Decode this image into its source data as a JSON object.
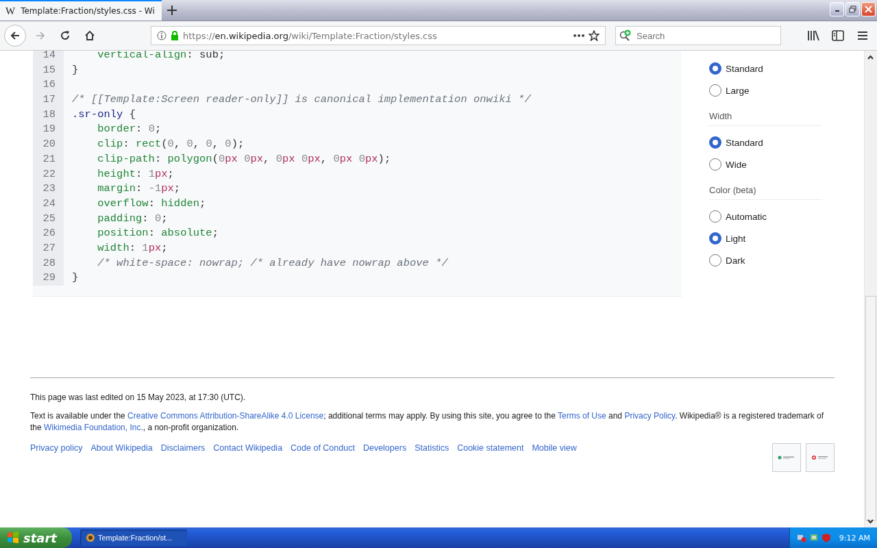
{
  "browser": {
    "tab": {
      "icon": "W",
      "title": "Template:Fraction/styles.css - Wi",
      "selected": true
    },
    "url": {
      "scheme": "https://",
      "domain": "en.wikipedia.org",
      "path": "/wiki/Template:Fraction/styles.css"
    },
    "search": {
      "placeholder": "Search"
    }
  },
  "code": {
    "lines": [
      {
        "number": "14",
        "indented": true,
        "tokens": [
          {
            "kind": "prop",
            "text": "vertical-align"
          },
          {
            "kind": "plain",
            "text": ": sub;"
          }
        ]
      },
      {
        "number": "15",
        "indented": false,
        "tokens": [
          {
            "kind": "plain",
            "text": "}"
          }
        ]
      },
      {
        "number": "16",
        "indented": false
      },
      {
        "number": "17",
        "indented": false,
        "tokens": [
          {
            "kind": "comment",
            "text": "/* [[Template:Screen reader-only]] is canonical implementation onwiki */"
          }
        ]
      },
      {
        "number": "18",
        "indented": false,
        "tokens": [
          {
            "kind": "selector",
            "text": ".sr-only"
          },
          {
            "kind": "plain",
            "text": " {"
          }
        ]
      },
      {
        "number": "19",
        "indented": true,
        "tokens": [
          {
            "kind": "prop",
            "text": "border"
          },
          {
            "kind": "plain",
            "text": ": "
          },
          {
            "kind": "num",
            "text": "0"
          },
          {
            "kind": "plain",
            "text": ";"
          }
        ]
      },
      {
        "number": "20",
        "indented": true,
        "tokens": [
          {
            "kind": "prop",
            "text": "clip"
          },
          {
            "kind": "plain",
            "text": ": "
          },
          {
            "kind": "func",
            "text": "rect"
          },
          {
            "kind": "plain",
            "text": "("
          },
          {
            "kind": "num",
            "text": "0"
          },
          {
            "kind": "plain",
            "text": ", "
          },
          {
            "kind": "num",
            "text": "0"
          },
          {
            "kind": "plain",
            "text": ", "
          },
          {
            "kind": "num",
            "text": "0"
          },
          {
            "kind": "plain",
            "text": ", "
          },
          {
            "kind": "num",
            "text": "0"
          },
          {
            "kind": "plain",
            "text": ");"
          }
        ]
      },
      {
        "number": "21",
        "indented": true,
        "tokens": [
          {
            "kind": "prop",
            "text": "clip-path"
          },
          {
            "kind": "plain",
            "text": ": "
          },
          {
            "kind": "func",
            "text": "polygon"
          },
          {
            "kind": "plain",
            "text": "("
          },
          {
            "kind": "num",
            "text": "0"
          },
          {
            "kind": "unit",
            "text": "px"
          },
          {
            "kind": "num",
            "text": " 0"
          },
          {
            "kind": "unit",
            "text": "px"
          },
          {
            "kind": "plain",
            "text": ", "
          },
          {
            "kind": "num",
            "text": "0"
          },
          {
            "kind": "unit",
            "text": "px"
          },
          {
            "kind": "num",
            "text": " 0"
          },
          {
            "kind": "unit",
            "text": "px"
          },
          {
            "kind": "plain",
            "text": ", "
          },
          {
            "kind": "num",
            "text": "0"
          },
          {
            "kind": "unit",
            "text": "px"
          },
          {
            "kind": "num",
            "text": " 0"
          },
          {
            "kind": "unit",
            "text": "px"
          },
          {
            "kind": "plain",
            "text": ");"
          }
        ]
      },
      {
        "number": "22",
        "indented": true,
        "tokens": [
          {
            "kind": "prop",
            "text": "height"
          },
          {
            "kind": "plain",
            "text": ": "
          },
          {
            "kind": "num",
            "text": "1"
          },
          {
            "kind": "unit",
            "text": "px"
          },
          {
            "kind": "plain",
            "text": ";"
          }
        ]
      },
      {
        "number": "23",
        "indented": true,
        "tokens": [
          {
            "kind": "prop",
            "text": "margin"
          },
          {
            "kind": "plain",
            "text": ": "
          },
          {
            "kind": "num",
            "text": "-1"
          },
          {
            "kind": "unit",
            "text": "px"
          },
          {
            "kind": "plain",
            "text": ";"
          }
        ]
      },
      {
        "number": "24",
        "indented": true,
        "tokens": [
          {
            "kind": "prop",
            "text": "overflow"
          },
          {
            "kind": "plain",
            "text": ": "
          },
          {
            "kind": "func",
            "text": "hidden"
          },
          {
            "kind": "plain",
            "text": ";"
          }
        ]
      },
      {
        "number": "25",
        "indented": true,
        "tokens": [
          {
            "kind": "prop",
            "text": "padding"
          },
          {
            "kind": "plain",
            "text": ": "
          },
          {
            "kind": "num",
            "text": "0"
          },
          {
            "kind": "plain",
            "text": ";"
          }
        ]
      },
      {
        "number": "26",
        "indented": true,
        "tokens": [
          {
            "kind": "prop",
            "text": "position"
          },
          {
            "kind": "plain",
            "text": ": "
          },
          {
            "kind": "func",
            "text": "absolute"
          },
          {
            "kind": "plain",
            "text": ";"
          }
        ]
      },
      {
        "number": "27",
        "indented": true,
        "tokens": [
          {
            "kind": "prop",
            "text": "width"
          },
          {
            "kind": "plain",
            "text": ": "
          },
          {
            "kind": "num",
            "text": "1"
          },
          {
            "kind": "unit",
            "text": "px"
          },
          {
            "kind": "plain",
            "text": ";"
          }
        ]
      },
      {
        "number": "28",
        "indented": true,
        "tokens": [
          {
            "kind": "comment",
            "text": "/* white-space: nowrap; /* already have nowrap above */"
          }
        ]
      },
      {
        "number": "29",
        "indented": false,
        "tokens": [
          {
            "kind": "plain",
            "text": "}"
          }
        ]
      }
    ]
  },
  "settings": {
    "groups": [
      {
        "options": [
          {
            "label": "Standard",
            "selected": true
          },
          {
            "label": "Large",
            "selected": false
          }
        ]
      },
      {
        "heading": "Width",
        "options": [
          {
            "label": "Standard",
            "selected": true
          },
          {
            "label": "Wide",
            "selected": false
          }
        ]
      },
      {
        "heading": "Color (beta)",
        "options": [
          {
            "label": "Automatic",
            "selected": false
          },
          {
            "label": "Light",
            "selected": true
          },
          {
            "label": "Dark",
            "selected": false
          }
        ]
      }
    ]
  },
  "footer": {
    "last_edited": "This page was last edited on 15 May 2023, at 17:30 (UTC).",
    "license": [
      {
        "kind": "text",
        "text": "Text is available under the "
      },
      {
        "kind": "link",
        "text": "Creative Commons Attribution-ShareAlike 4.0 License"
      },
      {
        "kind": "text",
        "text": "; additional terms may apply. By using this site, you agree to the "
      },
      {
        "kind": "link",
        "text": "Terms of Use"
      },
      {
        "kind": "text",
        "text": " and "
      },
      {
        "kind": "link",
        "text": "Privacy Policy"
      },
      {
        "kind": "text",
        "text": ". Wikipedia® is a registered trademark of the "
      },
      {
        "kind": "link",
        "text": "Wikimedia Foundation, Inc."
      },
      {
        "kind": "text",
        "text": ", a non-profit organization."
      }
    ],
    "links": [
      "Privacy policy",
      "About Wikipedia",
      "Disclaimers",
      "Contact Wikipedia",
      "Code of Conduct",
      "Developers",
      "Statistics",
      "Cookie statement",
      "Mobile view"
    ]
  },
  "taskbar": {
    "start": "start",
    "tasks": [
      {
        "label": "Template:Fraction/st...",
        "selected": true
      }
    ],
    "clock": "9:12 AM"
  }
}
